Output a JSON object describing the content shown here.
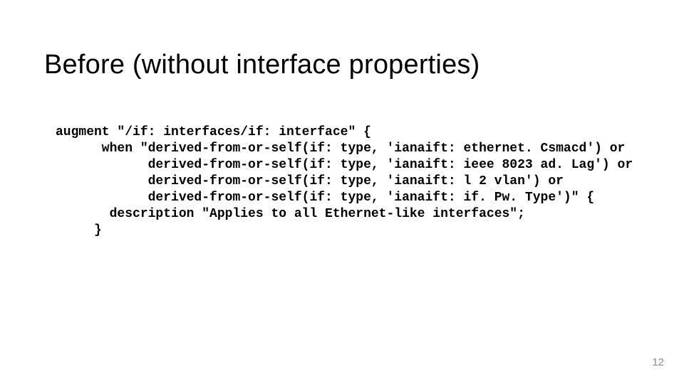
{
  "slide": {
    "title": "Before (without interface properties)",
    "code": {
      "l1": "augment \"/if: interfaces/if: interface\" {",
      "l2": "      when \"derived-from-or-self(if: type, 'ianaift: ethernet. Csmacd') or",
      "l3": "            derived-from-or-self(if: type, 'ianaift: ieee 8023 ad. Lag') or",
      "l4": "            derived-from-or-self(if: type, 'ianaift: l 2 vlan') or",
      "l5": "            derived-from-or-self(if: type, 'ianaift: if. Pw. Type')\" {",
      "l6": "       description \"Applies to all Ethernet-like interfaces\";",
      "l7": "     }"
    },
    "page_number": "12"
  }
}
